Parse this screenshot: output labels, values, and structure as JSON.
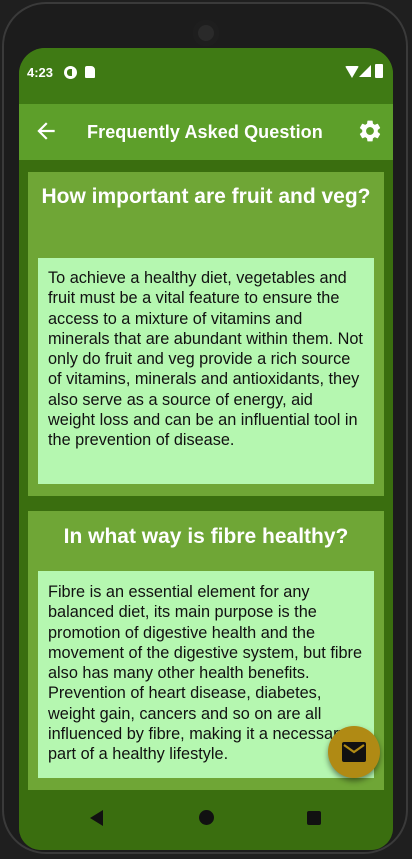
{
  "status_bar": {
    "time": "4:23",
    "icons": [
      "vpn-icon",
      "sd-card-icon",
      "wifi-icon",
      "signal-icon",
      "battery-icon"
    ]
  },
  "app_bar": {
    "title": "Frequently Asked Question",
    "back_icon": "arrow-back-icon",
    "settings_icon": "gear-icon"
  },
  "faq": [
    {
      "question": "How important are fruit and veg?",
      "answer": "To achieve a healthy diet, vegetables and fruit must be a vital feature to ensure the access to a mixture of vitamins and minerals that are abundant within them. Not only do fruit and veg provide a rich source of vitamins, minerals and antioxidants, they also serve as a source of energy, aid weight loss and can be an influential tool in the prevention of disease."
    },
    {
      "question": "In what way is fibre healthy?",
      "answer": "Fibre is an essential element for any balanced diet, its main purpose is the promotion of digestive health and the movement of the digestive system, but fibre also has many other health benefits. Prevention of heart disease, diabetes, weight gain, cancers and so on are all influenced by fibre, making it a necessary part of a healthy lifestyle."
    }
  ],
  "fab": {
    "icon": "mail-icon"
  },
  "nav_bar": {
    "icons": [
      "nav-back-icon",
      "nav-home-icon",
      "nav-recents-icon"
    ]
  },
  "colors": {
    "status_bar": "#3f7a14",
    "app_bar": "#5d9f2a",
    "card": "#6fa636",
    "answer_background": "#b5f7b0",
    "fab": "#b08a14",
    "background": "#3a6e0f"
  }
}
